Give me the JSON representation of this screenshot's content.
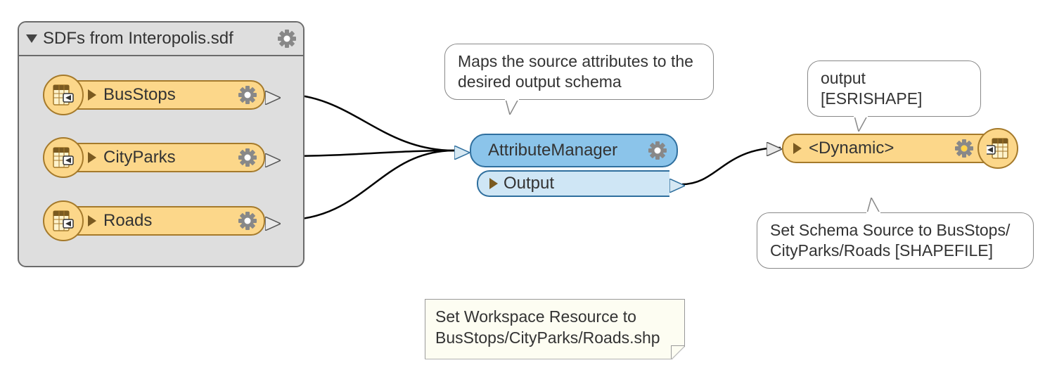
{
  "reader": {
    "title": "SDFs from Interopolis.sdf",
    "features": [
      "BusStops",
      "CityParks",
      "Roads"
    ]
  },
  "transformer": {
    "name": "AttributeManager",
    "tooltip": "Maps the source attributes to the desired output schema",
    "output_port": "Output"
  },
  "writer": {
    "feature_label": "<Dynamic>",
    "top_bubble": "output [ESRISHAPE]",
    "bottom_bubble": "Set Schema Source to BusStops/ CityParks/Roads [SHAPEFILE]"
  },
  "note": {
    "text": "Set Workspace Resource to BusStops/CityParks/Roads.shp"
  }
}
